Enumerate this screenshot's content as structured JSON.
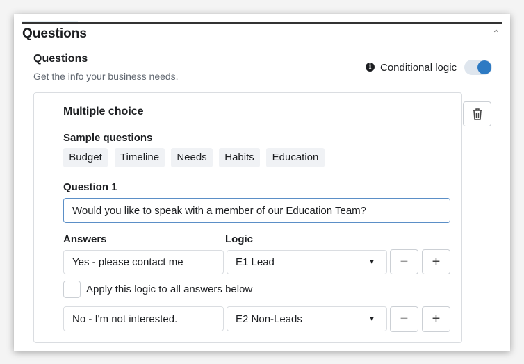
{
  "section": {
    "title": "Questions"
  },
  "questions": {
    "title": "Questions",
    "subtitle": "Get the info your business needs.",
    "conditional_logic_label": "Conditional logic",
    "conditional_logic_on": true,
    "toggle_color": "#2d7ac3"
  },
  "card": {
    "type_title": "Multiple choice",
    "sample_label": "Sample questions",
    "samples": [
      "Budget",
      "Timeline",
      "Needs",
      "Habits",
      "Education"
    ],
    "question_label": "Question 1",
    "question_value": "Would you like to speak with a member of our Education Team?",
    "answers_label": "Answers",
    "logic_label": "Logic",
    "rows": [
      {
        "answer": "Yes - please contact me",
        "logic": "E1 Lead"
      },
      {
        "answer": "No - I'm not interested.",
        "logic": "E2 Non-Leads"
      }
    ],
    "apply_label": "Apply this logic to all answers below",
    "apply_checked": false
  },
  "icons": {
    "collapse": "chevron-up-icon",
    "info": "info-icon",
    "delete": "trash-icon",
    "dropdown": "caret-down-icon",
    "remove": "minus-icon",
    "add": "plus-icon"
  }
}
